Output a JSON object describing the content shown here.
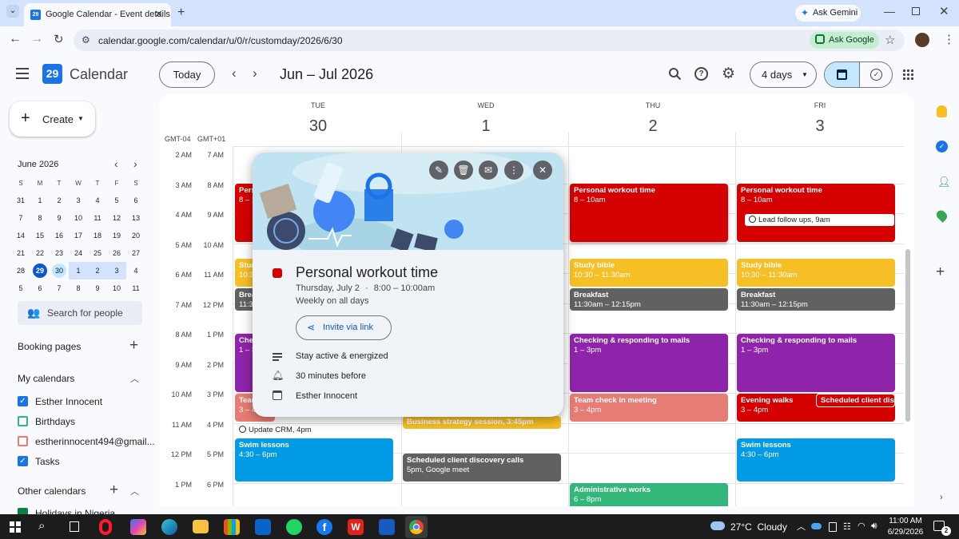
{
  "browser": {
    "tab_title": "Google Calendar - Event details",
    "tab_favicon": "29",
    "ask_gemini": "Ask Gemini",
    "url": "calendar.google.com/calendar/u/0/r/customday/2026/6/30",
    "ask_google": "Ask Google"
  },
  "header": {
    "app_name": "Calendar",
    "logo_num": "29",
    "today": "Today",
    "date_range": "Jun – Jul 2026",
    "view": "4 days"
  },
  "sidebar": {
    "create": "Create",
    "mini_title": "June 2026",
    "weekdays": [
      "S",
      "M",
      "T",
      "W",
      "T",
      "F",
      "S"
    ],
    "weeks": [
      [
        "31",
        "1",
        "2",
        "3",
        "4",
        "5",
        "6"
      ],
      [
        "7",
        "8",
        "9",
        "10",
        "11",
        "12",
        "13"
      ],
      [
        "14",
        "15",
        "16",
        "17",
        "18",
        "19",
        "20"
      ],
      [
        "21",
        "22",
        "23",
        "24",
        "25",
        "26",
        "27"
      ],
      [
        "28",
        "29",
        "30",
        "1",
        "2",
        "3",
        "4"
      ],
      [
        "5",
        "6",
        "7",
        "8",
        "9",
        "10",
        "11"
      ]
    ],
    "search_people": "Search for people",
    "booking_pages": "Booking pages",
    "my_calendars": "My calendars",
    "calendars": [
      {
        "name": "Esther Innocent",
        "checked": true,
        "color": "#1a73e8"
      },
      {
        "name": "Birthdays",
        "checked": false,
        "color": "#33b679"
      },
      {
        "name": "estherinnocent494@gmail...",
        "checked": false,
        "color": "#e67c73"
      },
      {
        "name": "Tasks",
        "checked": true,
        "color": "#1a73e8"
      }
    ],
    "other_calendars": "Other calendars",
    "holidays": "Holidays in Nigeria"
  },
  "grid": {
    "tz1": "GMT-04",
    "tz2": "GMT+01",
    "days": [
      {
        "name": "TUE",
        "num": "30"
      },
      {
        "name": "WED",
        "num": "1"
      },
      {
        "name": "THU",
        "num": "2"
      },
      {
        "name": "FRI",
        "num": "3"
      }
    ],
    "times1": [
      "2 AM",
      "3 AM",
      "4 AM",
      "5 AM",
      "6 AM",
      "7 AM",
      "8 AM",
      "9 AM",
      "10 AM",
      "11 AM",
      "12 PM",
      "1 PM"
    ],
    "times2": [
      "7 AM",
      "8 AM",
      "9 AM",
      "10 AM",
      "11 AM",
      "12 PM",
      "1 PM",
      "2 PM",
      "3 PM",
      "4 PM",
      "5 PM",
      "6 PM"
    ]
  },
  "events": {
    "tue_pers_a": "Pers",
    "tue_pers_b": "8 – 1",
    "tue_stud_a": "Stud",
    "tue_stud_b": "10:3",
    "tue_brea_a": "Brea",
    "tue_brea_b": "11:3",
    "tue_che_a": "Che",
    "tue_che_b": "1 – 3",
    "tue_tea_a": "Tean",
    "tue_tea_b": "3 – 4",
    "tue_crm": "Update CRM, 4pm",
    "tue_swim_t": "Swim lessons",
    "tue_swim_s": "4:30 – 6pm",
    "wed_biz": "Business strategy session, 3:45pm",
    "wed_sched_t": "Scheduled client discovery calls",
    "wed_sched_s": "5pm, Google meet",
    "thu_work_t": "Personal workout time",
    "thu_work_s": "8 – 10am",
    "thu_bible_t": "Study bible",
    "thu_bible_s": "10:30 – 11:30am",
    "thu_bf_t": "Breakfast",
    "thu_bf_s": "11:30am – 12:15pm",
    "thu_mail_t": "Checking & responding to mails",
    "thu_mail_s": "1 – 3pm",
    "thu_team_t": "Team check in meeting",
    "thu_team_s": "3 – 4pm",
    "thu_admin_t": "Administrative works",
    "thu_admin_s": "6 – 8pm",
    "fri_work_t": "Personal workout time",
    "fri_work_s": "8 – 10am",
    "fri_lead": "Lead follow ups, 9am",
    "fri_bible_t": "Study bible",
    "fri_bible_s": "10:30 – 11:30am",
    "fri_bf_t": "Breakfast",
    "fri_bf_s": "11:30am – 12:15pm",
    "fri_mail_t": "Checking & responding to mails",
    "fri_mail_s": "1 – 3pm",
    "fri_walk_t": "Evening walks",
    "fri_walk_s": "3 – 4pm",
    "fri_sched": "Scheduled client disc",
    "fri_swim_t": "Swim lessons",
    "fri_swim_s": "4:30 – 6pm"
  },
  "popup": {
    "title": "Personal workout time",
    "date": "Thursday, July 2",
    "dot": "·",
    "time": "8:00 – 10:00am",
    "recurrence": "Weekly on all days",
    "invite": "Invite via link",
    "description": "Stay active & energized",
    "reminder": "30 minutes before",
    "calendar": "Esther Innocent"
  },
  "taskbar": {
    "weather": "27°C  Cloudy",
    "time": "11:00 AM",
    "date": "6/29/2026",
    "notif": "2"
  },
  "colors": {
    "red": "#d50000",
    "yellow": "#f6bf26",
    "gray": "#616161",
    "purple": "#8e24aa",
    "salmon": "#e67c73",
    "blue": "#039be5",
    "green": "#33b679"
  }
}
